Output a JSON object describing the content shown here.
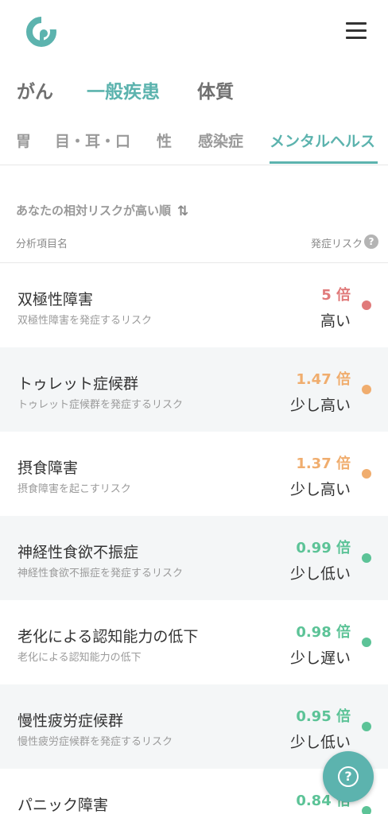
{
  "colors": {
    "accent": "#5cb3ae",
    "high": "#e07a7a",
    "slightly_high": "#f0ad6e",
    "low": "#5cc397"
  },
  "header": {
    "logo_icon": "brand-logo-icon",
    "menu_icon": "hamburger-menu-icon"
  },
  "category_tabs": [
    {
      "label": "がん",
      "active": false
    },
    {
      "label": "一般疾患",
      "active": true
    },
    {
      "label": "体質",
      "active": false
    }
  ],
  "sub_tabs": [
    {
      "label": "胃",
      "active": false
    },
    {
      "label": "目・耳・口",
      "active": false
    },
    {
      "label": "性",
      "active": false
    },
    {
      "label": "感染症",
      "active": false
    },
    {
      "label": "メンタルヘルス",
      "active": true
    }
  ],
  "sort": {
    "label": "あなたの相対リスクが高い順",
    "icon": "sort-updown-icon"
  },
  "columns": {
    "left": "分析項目名",
    "right": "発症リスク",
    "help_icon": "question-icon"
  },
  "items": [
    {
      "title": "双極性障害",
      "subtitle": "双極性障害を発症するリスク",
      "ratio": "5 倍",
      "level": "高い",
      "color": "#e07a7a"
    },
    {
      "title": "トゥレット症候群",
      "subtitle": "トゥレット症候群を発症するリスク",
      "ratio": "1.47 倍",
      "level": "少し高い",
      "color": "#f0ad6e"
    },
    {
      "title": "摂食障害",
      "subtitle": "摂食障害を起こすリスク",
      "ratio": "1.37 倍",
      "level": "少し高い",
      "color": "#f0ad6e"
    },
    {
      "title": "神経性食欲不振症",
      "subtitle": "神経性食欲不振症を発症するリスク",
      "ratio": "0.99 倍",
      "level": "少し低い",
      "color": "#5cc397"
    },
    {
      "title": "老化による認知能力の低下",
      "subtitle": "老化による認知能力の低下",
      "ratio": "0.98 倍",
      "level": "少し遅い",
      "color": "#5cc397"
    },
    {
      "title": "慢性疲労症候群",
      "subtitle": "慢性疲労症候群を発症するリスク",
      "ratio": "0.95 倍",
      "level": "少し低い",
      "color": "#5cc397"
    },
    {
      "title": "パニック障害",
      "subtitle": "",
      "ratio": "0.84 倍",
      "level": "",
      "color": "#5cc397"
    }
  ],
  "fab": {
    "icon": "help-question-icon",
    "symbol": "?"
  }
}
